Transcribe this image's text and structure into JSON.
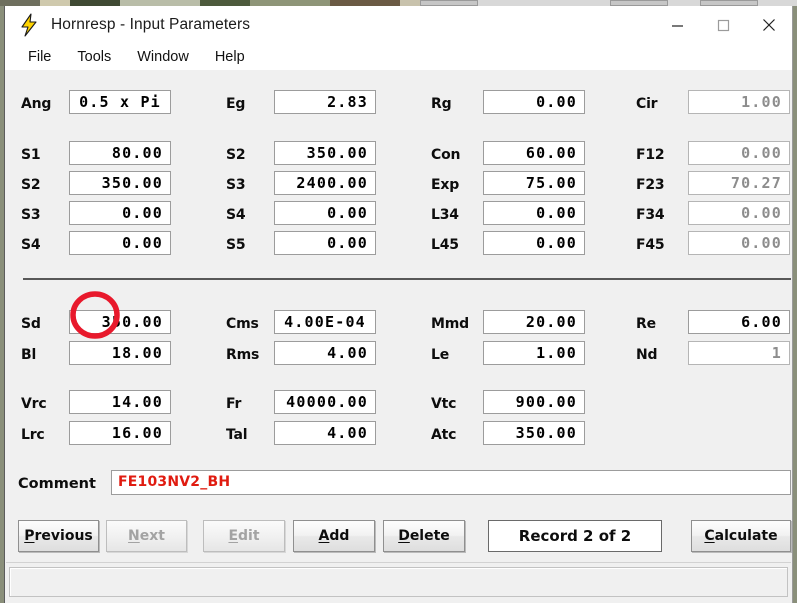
{
  "window": {
    "title": "Hornresp - Input Parameters",
    "app_icon": "lightning-bolt-icon",
    "controls": {
      "minimize": "—",
      "maximize": "□",
      "close": "✕"
    }
  },
  "menu": {
    "items": [
      "File",
      "Tools",
      "Window",
      "Help"
    ]
  },
  "fields": {
    "col1": [
      {
        "label": "Ang",
        "value": "0.5 x Pi",
        "disabled": false,
        "align": "center"
      },
      {
        "label": "S1",
        "value": "80.00",
        "disabled": false
      },
      {
        "label": "S2",
        "value": "350.00",
        "disabled": false
      },
      {
        "label": "S3",
        "value": "0.00",
        "disabled": false
      },
      {
        "label": "S4",
        "value": "0.00",
        "disabled": false
      }
    ],
    "col2": [
      {
        "label": "Eg",
        "value": "2.83",
        "disabled": false
      },
      {
        "label": "S2",
        "value": "350.00",
        "disabled": false
      },
      {
        "label": "S3",
        "value": "2400.00",
        "disabled": false
      },
      {
        "label": "S4",
        "value": "0.00",
        "disabled": false
      },
      {
        "label": "S5",
        "value": "0.00",
        "disabled": false
      }
    ],
    "col3": [
      {
        "label": "Rg",
        "value": "0.00",
        "disabled": false
      },
      {
        "label": "Con",
        "value": "60.00",
        "disabled": false
      },
      {
        "label": "Exp",
        "value": "75.00",
        "disabled": false
      },
      {
        "label": "L34",
        "value": "0.00",
        "disabled": false
      },
      {
        "label": "L45",
        "value": "0.00",
        "disabled": false
      }
    ],
    "col4": [
      {
        "label": "Cir",
        "value": "1.00",
        "disabled": true
      },
      {
        "label": "F12",
        "value": "0.00",
        "disabled": true
      },
      {
        "label": "F23",
        "value": "70.27",
        "disabled": true
      },
      {
        "label": "F34",
        "value": "0.00",
        "disabled": true
      },
      {
        "label": "F45",
        "value": "0.00",
        "disabled": true
      }
    ],
    "driver_col1": [
      {
        "label": "Sd",
        "value": "350.00",
        "disabled": false
      },
      {
        "label": "Bl",
        "value": "18.00",
        "disabled": false
      }
    ],
    "driver_col2": [
      {
        "label": "Cms",
        "value": "4.00E-04",
        "disabled": false
      },
      {
        "label": "Rms",
        "value": "4.00",
        "disabled": false
      }
    ],
    "driver_col3": [
      {
        "label": "Mmd",
        "value": "20.00",
        "disabled": false
      },
      {
        "label": "Le",
        "value": "1.00",
        "disabled": false
      }
    ],
    "driver_col4": [
      {
        "label": "Re",
        "value": "6.00",
        "disabled": false
      },
      {
        "label": "Nd",
        "value": "1",
        "disabled": true
      }
    ],
    "chamber_col1": [
      {
        "label": "Vrc",
        "value": "14.00",
        "disabled": false
      },
      {
        "label": "Lrc",
        "value": "16.00",
        "disabled": false
      }
    ],
    "chamber_col2": [
      {
        "label": "Fr",
        "value": "40000.00",
        "disabled": false
      },
      {
        "label": "Tal",
        "value": "4.00",
        "disabled": false
      }
    ],
    "chamber_col3": [
      {
        "label": "Vtc",
        "value": "900.00",
        "disabled": false
      },
      {
        "label": "Atc",
        "value": "350.00",
        "disabled": false
      }
    ]
  },
  "comment": {
    "label": "Comment",
    "value": "FE103NV2_BH"
  },
  "buttons": [
    {
      "name": "previous",
      "label": "Previous",
      "accel": "P",
      "disabled": false
    },
    {
      "name": "next",
      "label": "Next",
      "accel": "N",
      "disabled": true
    },
    {
      "name": "edit",
      "label": "Edit",
      "accel": "E",
      "disabled": true
    },
    {
      "name": "add",
      "label": "Add",
      "accel": "A",
      "disabled": false
    },
    {
      "name": "delete",
      "label": "Delete",
      "accel": "D",
      "disabled": false
    }
  ],
  "record_status": "Record 2 of 2",
  "calculate_button": {
    "label": "Calculate",
    "accel": "C"
  },
  "annotation": {
    "type": "red-circle-highlight",
    "target": "Sd value",
    "color": "#e8192c"
  },
  "colors": {
    "face": "#f0f0f0",
    "field_bg": "#ffffff",
    "comment_text": "#e01b10",
    "annotation": "#e8192c"
  }
}
